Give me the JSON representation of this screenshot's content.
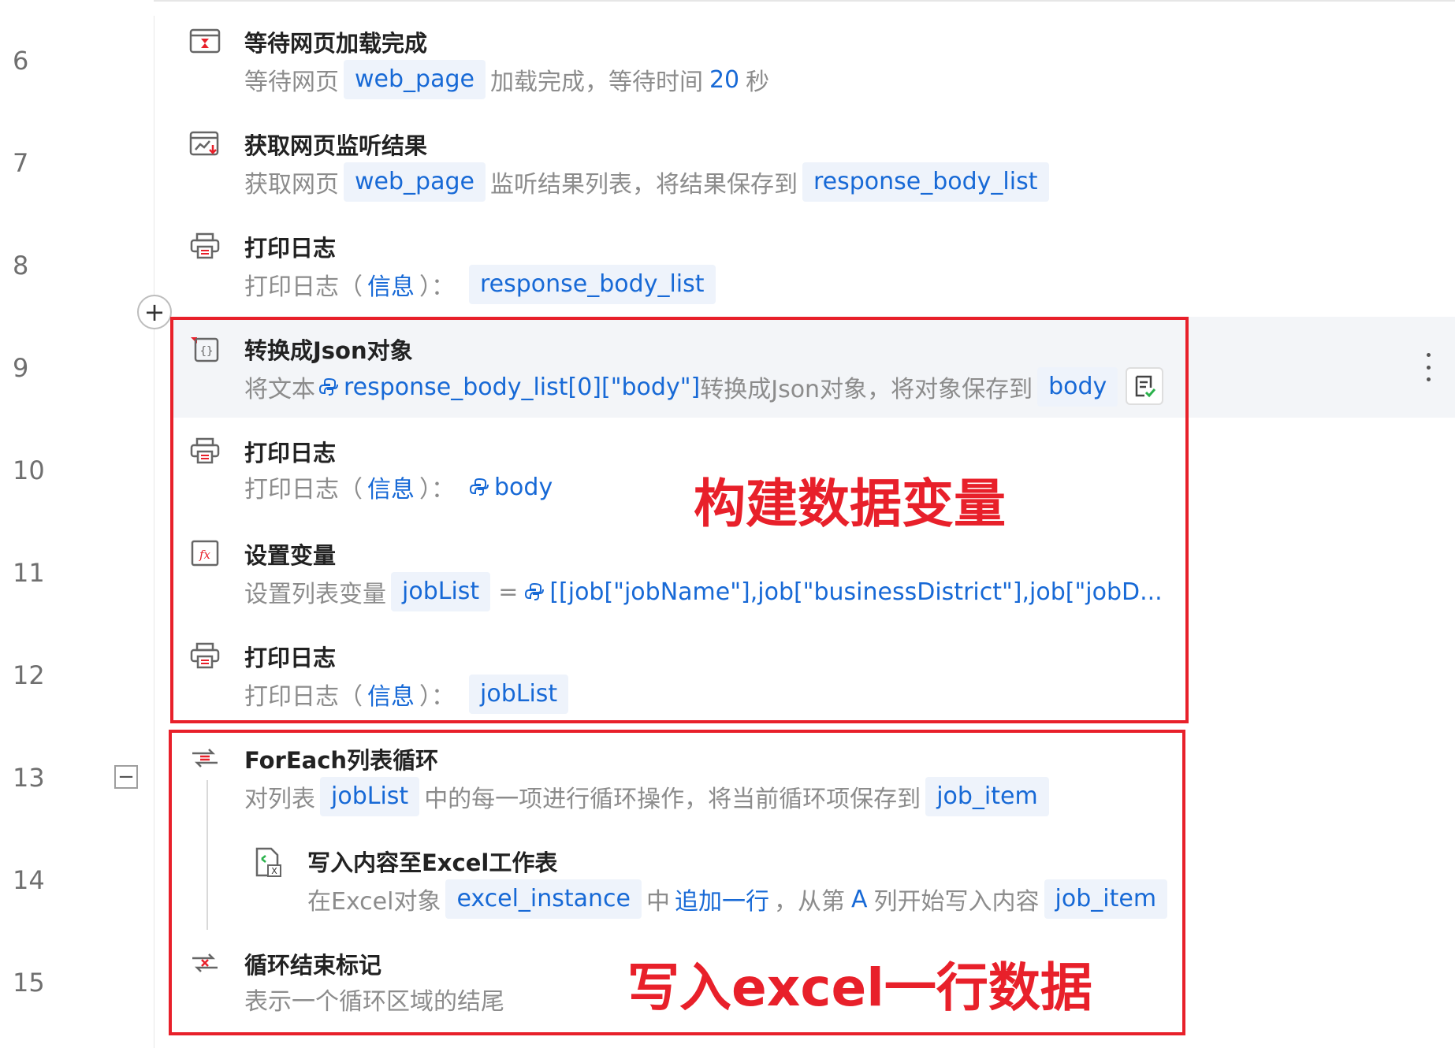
{
  "line_numbers": [
    "6",
    "7",
    "8",
    "9",
    "10",
    "11",
    "12",
    "13",
    "14",
    "15"
  ],
  "steps": {
    "s6": {
      "icon": "hourglass-browser-icon",
      "title": "等待网页加载完成",
      "p1": "等待网页",
      "var1": "web_page",
      "p2": "加载完成，等待时间",
      "value": "20",
      "p3": "秒"
    },
    "s7": {
      "icon": "browser-chart-icon",
      "title": "获取网页监听结果",
      "p1": "获取网页",
      "var1": "web_page",
      "p2": "监听结果列表，将结果保存到",
      "var2": "response_body_list"
    },
    "s8": {
      "icon": "printer-icon",
      "title": "打印日志",
      "p1": "打印日志（",
      "level": "信息",
      "p2": "）：",
      "var1": "response_body_list"
    },
    "s9": {
      "icon": "json-braces-icon",
      "title": "转换成Json对象",
      "p1": "将文本",
      "expr": "response_body_list[0][\"body\"]",
      "p2": "转换成Json对象，将对象保存到",
      "var1": "body"
    },
    "s10": {
      "icon": "printer-icon",
      "title": "打印日志",
      "p1": "打印日志（",
      "level": "信息",
      "p2": "）：",
      "expr": "body"
    },
    "s11": {
      "icon": "fx-function-icon",
      "title": "设置变量",
      "p1": "设置列表变量",
      "var1": "jobList",
      "eq": "=",
      "expr": "[[job[\"jobName\"],job[\"businessDistrict\"],job[\"jobD..."
    },
    "s12": {
      "icon": "printer-icon",
      "title": "打印日志",
      "p1": "打印日志（",
      "level": "信息",
      "p2": "）：",
      "var1": "jobList"
    },
    "s13": {
      "icon": "loop-list-icon",
      "title": "ForEach列表循环",
      "p1": "对列表",
      "var1": "jobList",
      "p2": "中的每一项进行循环操作，将当前循环项保存到",
      "var2": "job_item"
    },
    "s14": {
      "icon": "excel-file-icon",
      "title": "写入内容至Excel工作表",
      "p1": "在Excel对象",
      "var1": "excel_instance",
      "p2": "中",
      "mode": "追加一行",
      "p3": "，从第",
      "col": "A",
      "p4": "列开始写入内容",
      "var2": "job_item"
    },
    "s15": {
      "icon": "loop-end-icon",
      "title": "循环结束标记",
      "p1": "表示一个循环区域的结尾"
    }
  },
  "annotations": {
    "box1_label": "构建数据变量",
    "box2_label": "写入excel一行数据"
  },
  "colors": {
    "accent_blue": "#1769d6",
    "chip_bg": "#eef3fb",
    "annotation_red": "#e8202a",
    "highlight_row": "#f3f5f8"
  }
}
